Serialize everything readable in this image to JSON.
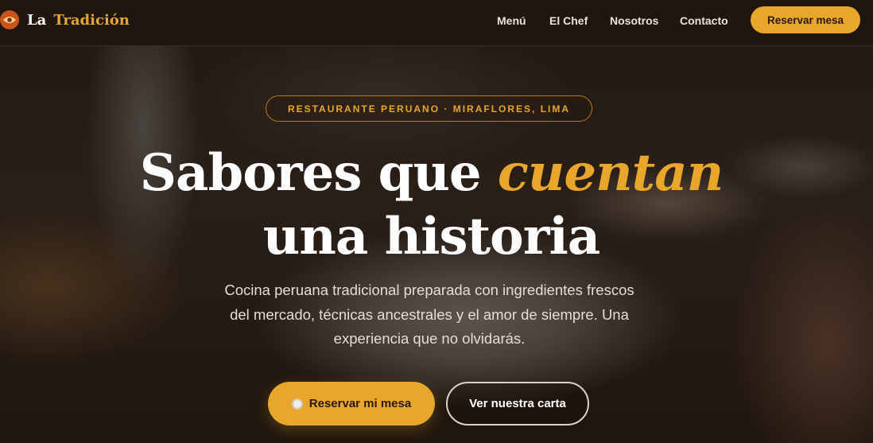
{
  "brand": {
    "name_part1": "La",
    "name_part2": "Tradición",
    "logo_icon": "eye-logo-icon"
  },
  "nav": {
    "links": [
      "Menú",
      "El Chef",
      "Nosotros",
      "Contacto"
    ],
    "cta_label": "Reservar mesa"
  },
  "hero": {
    "badge": "RESTAURANTE PERUANO · MIRAFLORES, LIMA",
    "headline_part1": "Sabores que",
    "headline_accent": "cuentan",
    "headline_line2": "una historia",
    "description": "Cocina peruana tradicional preparada con ingredientes frescos del mercado, técnicas ancestrales y el amor de siempre. Una experiencia que no olvidarás.",
    "primary_button": "Reservar mi mesa",
    "primary_icon": "plate-icon",
    "secondary_button": "Ver nuestra carta"
  },
  "colors": {
    "accent": "#e8a72b",
    "nav_background": "#1f1610",
    "logo_circle": "#c9531c",
    "text_light": "#e6ddd5"
  }
}
